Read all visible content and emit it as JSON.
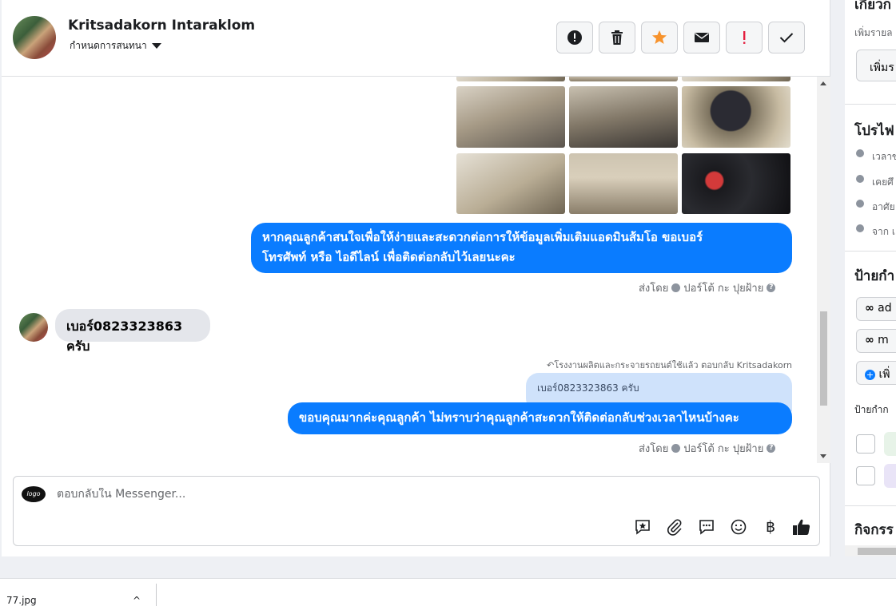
{
  "header": {
    "contact_name": "Kritsadakorn Intaraklom",
    "assign_label": "กำหนดการสนทนา",
    "actions": [
      {
        "name": "report-spam-button",
        "icon": "exclamation-circle-icon"
      },
      {
        "name": "delete-button",
        "icon": "trash-icon"
      },
      {
        "name": "star-button",
        "icon": "star-icon"
      },
      {
        "name": "mark-unread-button",
        "icon": "envelope-icon"
      },
      {
        "name": "follow-up-button",
        "icon": "exclamation-icon"
      },
      {
        "name": "mark-done-button",
        "icon": "check-icon"
      }
    ]
  },
  "messages": {
    "outgoing_1_line1": "หากคุณลูกค้าสนใจเพื่อให้ง่ายและสะดวกต่อการให้ข้อมูลเพิ่มเติมแอดมินส้มโอ ขอเบอร์",
    "outgoing_1_line2": "โทรศัพท์ หรือ ไอดีไลน์ เพื่อติดต่อกลับไว้เลยนะคะ",
    "sent_by_1": "ส่งโดย",
    "sender_1": "ปอร์โต้ กะ ปุยฝ้าย",
    "incoming_1": "เบอร์0823323863 ครับ",
    "reply_context": "โรงงานผลิตและกระจายรถยนต์ใช้แล้ว ตอบกลับ Kritsadakorn",
    "quoted_text": "เบอร์0823323863 ครับ",
    "outgoing_2": "ขอบคุณมากค่ะคุณลูกค้า ไม่ทราบว่าคุณลูกค้าสะดวกให้ติดต่อกลับช่วงเวลาไหนบ้างคะ",
    "sent_by_2": "ส่งโดย",
    "sender_2": "ปอร์โต้ กะ ปุยฝ้าย"
  },
  "composer": {
    "placeholder": "ตอบกลับใน Messenger...",
    "tools": [
      "saved-reply-icon",
      "attachment-icon",
      "chat-bubble-icon",
      "emoji-icon",
      "baht-icon",
      "thumbs-up-icon"
    ],
    "baht_symbol": "฿"
  },
  "sidebar": {
    "section_top_heading": "เกี่ยวก",
    "add_detail_label": "เพิ่มรายล",
    "add_button": "เพิ่มร",
    "profile_heading": "โปรไฟ",
    "profile_items": [
      "เวลาข",
      "เคยศึ",
      "อาศัย",
      "จาก เ"
    ],
    "labels_heading": "ป้ายกำ",
    "label_items": [
      "ad",
      "m"
    ],
    "add_label": "เพิ่",
    "tags_heading": "ป้ายกำก",
    "activity_heading": "กิจกรร",
    "tag_colors": [
      "#e7f3e8",
      "#e9e4f7"
    ]
  },
  "download": {
    "file_name": "77.jpg",
    "chevron": "^"
  },
  "colors": {
    "accent": "#0a7cff",
    "star": "#f7932d",
    "alert": "#e41e3f"
  }
}
